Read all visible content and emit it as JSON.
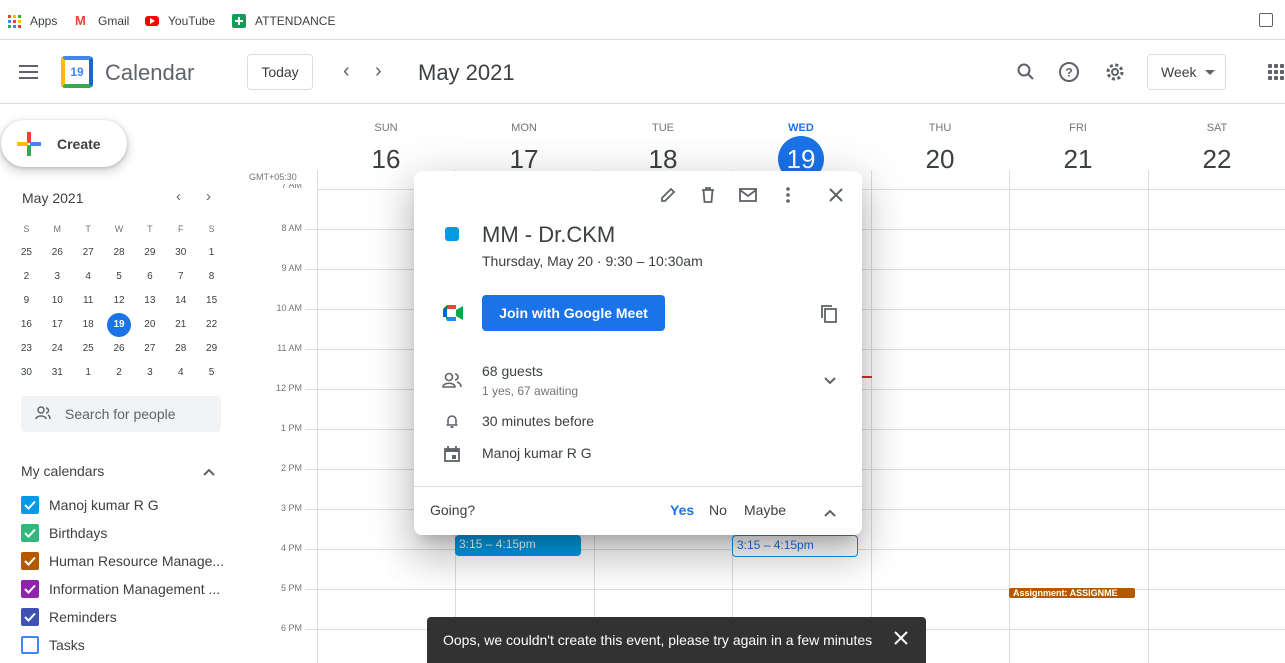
{
  "bookmarks": [
    {
      "label": "Apps",
      "icon": "apps-icon"
    },
    {
      "label": "Gmail",
      "icon": "gmail-icon"
    },
    {
      "label": "YouTube",
      "icon": "youtube-icon"
    },
    {
      "label": "ATTENDANCE",
      "icon": "sheets-icon"
    }
  ],
  "header": {
    "logo_day": "19",
    "app_title": "Calendar",
    "today_label": "Today",
    "month_title": "May 2021",
    "view_label": "Week"
  },
  "sidebar": {
    "create_label": "Create",
    "mini_month": "May 2021",
    "dow": [
      "S",
      "M",
      "T",
      "W",
      "T",
      "F",
      "S"
    ],
    "weeks": [
      [
        "25",
        "26",
        "27",
        "28",
        "29",
        "30",
        "1"
      ],
      [
        "2",
        "3",
        "4",
        "5",
        "6",
        "7",
        "8"
      ],
      [
        "9",
        "10",
        "11",
        "12",
        "13",
        "14",
        "15"
      ],
      [
        "16",
        "17",
        "18",
        "19",
        "20",
        "21",
        "22"
      ],
      [
        "23",
        "24",
        "25",
        "26",
        "27",
        "28",
        "29"
      ],
      [
        "30",
        "31",
        "1",
        "2",
        "3",
        "4",
        "5"
      ]
    ],
    "selected_day": "19",
    "search_people_placeholder": "Search for people",
    "my_calendars_title": "My calendars",
    "calendars": [
      {
        "label": "Manoj kumar R G",
        "color": "#039be5",
        "checked": true
      },
      {
        "label": "Birthdays",
        "color": "#33b679",
        "checked": true
      },
      {
        "label": "Human Resource Manage...",
        "color": "#b35900",
        "checked": true
      },
      {
        "label": "Information Management ...",
        "color": "#8e24aa",
        "checked": true
      },
      {
        "label": "Reminders",
        "color": "#3f51b5",
        "checked": true
      },
      {
        "label": "Tasks",
        "color": "#4285f4",
        "checked": false
      }
    ]
  },
  "week": {
    "gmt_label": "GMT+05:30",
    "days": [
      {
        "dow": "SUN",
        "date": "16"
      },
      {
        "dow": "MON",
        "date": "17"
      },
      {
        "dow": "TUE",
        "date": "18"
      },
      {
        "dow": "WED",
        "date": "19",
        "today": true
      },
      {
        "dow": "THU",
        "date": "20"
      },
      {
        "dow": "FRI",
        "date": "21"
      },
      {
        "dow": "SAT",
        "date": "22"
      }
    ],
    "time_labels": [
      "7 AM",
      "8 AM",
      "9 AM",
      "10 AM",
      "11 AM",
      "12 PM",
      "1 PM",
      "2 PM",
      "3 PM",
      "4 PM",
      "5 PM",
      "6 PM"
    ],
    "events": [
      {
        "label": "3:15 – 4:15pm",
        "day": "MON",
        "style": "filled"
      },
      {
        "label": "3:15 – 4:15pm",
        "day": "WED",
        "style": "outlined"
      },
      {
        "label": "Assignment: ASSIGNME",
        "day": "FRI",
        "style": "assignment"
      }
    ]
  },
  "popup": {
    "title": "MM - Dr.CKM",
    "time": "Thursday, May 20  ·  9:30 – 10:30am",
    "join_label": "Join with Google Meet",
    "guests_count": "68 guests",
    "guests_sub": "1 yes, 67 awaiting",
    "reminder": "30 minutes before",
    "organizer": "Manoj kumar R G",
    "going_label": "Going?",
    "rsvp_yes": "Yes",
    "rsvp_no": "No",
    "rsvp_maybe": "Maybe",
    "colors": {
      "event": "#039be5",
      "accent": "#1a73e8"
    }
  },
  "snackbar": {
    "message": "Oops, we couldn't create this event, please try again in a few minutes"
  }
}
